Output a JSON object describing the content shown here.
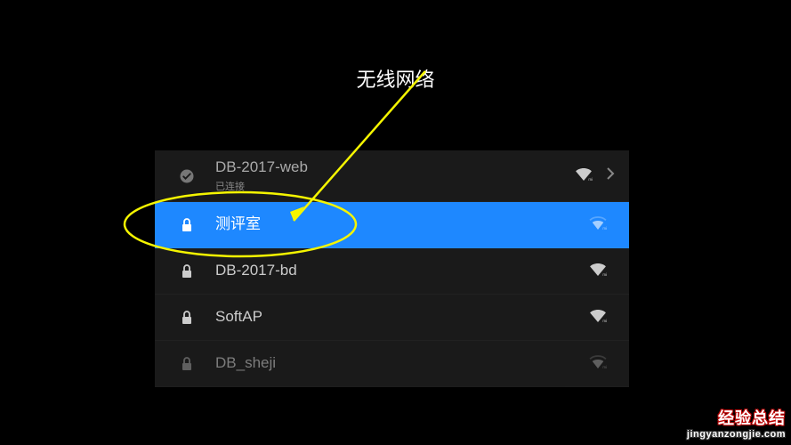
{
  "page": {
    "title": "无线网络"
  },
  "networks": [
    {
      "name": "DB-2017-web",
      "status": "已连接",
      "secured": false,
      "connected": true,
      "selected": false,
      "signal": 3,
      "hasChevron": true
    },
    {
      "name": "测评室",
      "status": "",
      "secured": true,
      "connected": false,
      "selected": true,
      "signal": 2,
      "hasChevron": false
    },
    {
      "name": "DB-2017-bd",
      "status": "",
      "secured": true,
      "connected": false,
      "selected": false,
      "signal": 3,
      "hasChevron": false
    },
    {
      "name": "SoftAP",
      "status": "",
      "secured": true,
      "connected": false,
      "selected": false,
      "signal": 3,
      "hasChevron": false
    },
    {
      "name": "DB_sheji",
      "status": "",
      "secured": true,
      "connected": false,
      "selected": false,
      "signal": 2,
      "hasChevron": false,
      "dim": true
    }
  ],
  "watermark": {
    "line1": "经验总结",
    "line2": "jingyanzongjie.com"
  }
}
